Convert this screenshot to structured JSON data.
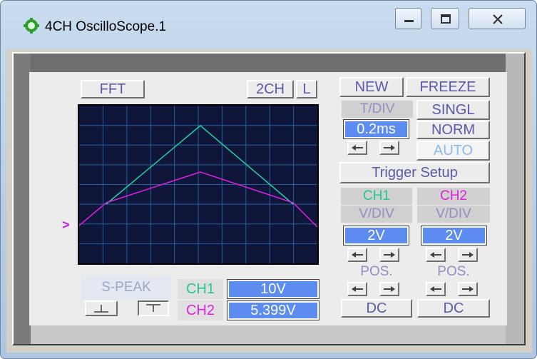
{
  "window": {
    "title": "4CH OscilloScope.1",
    "accent": "#b7cde6",
    "caption_buttons": [
      "minimize-icon",
      "maximize-icon",
      "close-icon"
    ]
  },
  "scope": {
    "fft_label": "FFT",
    "mode_2ch_label": "2CH",
    "l_label": "L",
    "trigger_marker": ">",
    "colors": {
      "ch1": "#20d0a0",
      "ch2": "#e020e0",
      "grid": "#2060a0",
      "screen": "#10163a",
      "value_bg": "#5c8cf0"
    }
  },
  "controls": {
    "new_label": "NEW",
    "freeze_label": "FREEZE",
    "tdiv_label": "T/DIV",
    "tdiv_value": "0.2ms",
    "singl_label": "SINGL",
    "norm_label": "NORM",
    "auto_label": "AUTO",
    "trigger_setup_label": "Trigger Setup"
  },
  "channels": [
    {
      "name": "CH1",
      "vdiv_label": "V/DIV",
      "vdiv_value": "2V",
      "pos_label": "POS.",
      "coupling": "DC"
    },
    {
      "name": "CH2",
      "vdiv_label": "V/DIV",
      "vdiv_value": "2V",
      "pos_label": "POS.",
      "coupling": "DC"
    }
  ],
  "peak": {
    "label": "S-PEAK",
    "ch1_label": "CH1",
    "ch1_value": "10V",
    "ch2_label": "CH2",
    "ch2_value": "5.399V"
  }
}
